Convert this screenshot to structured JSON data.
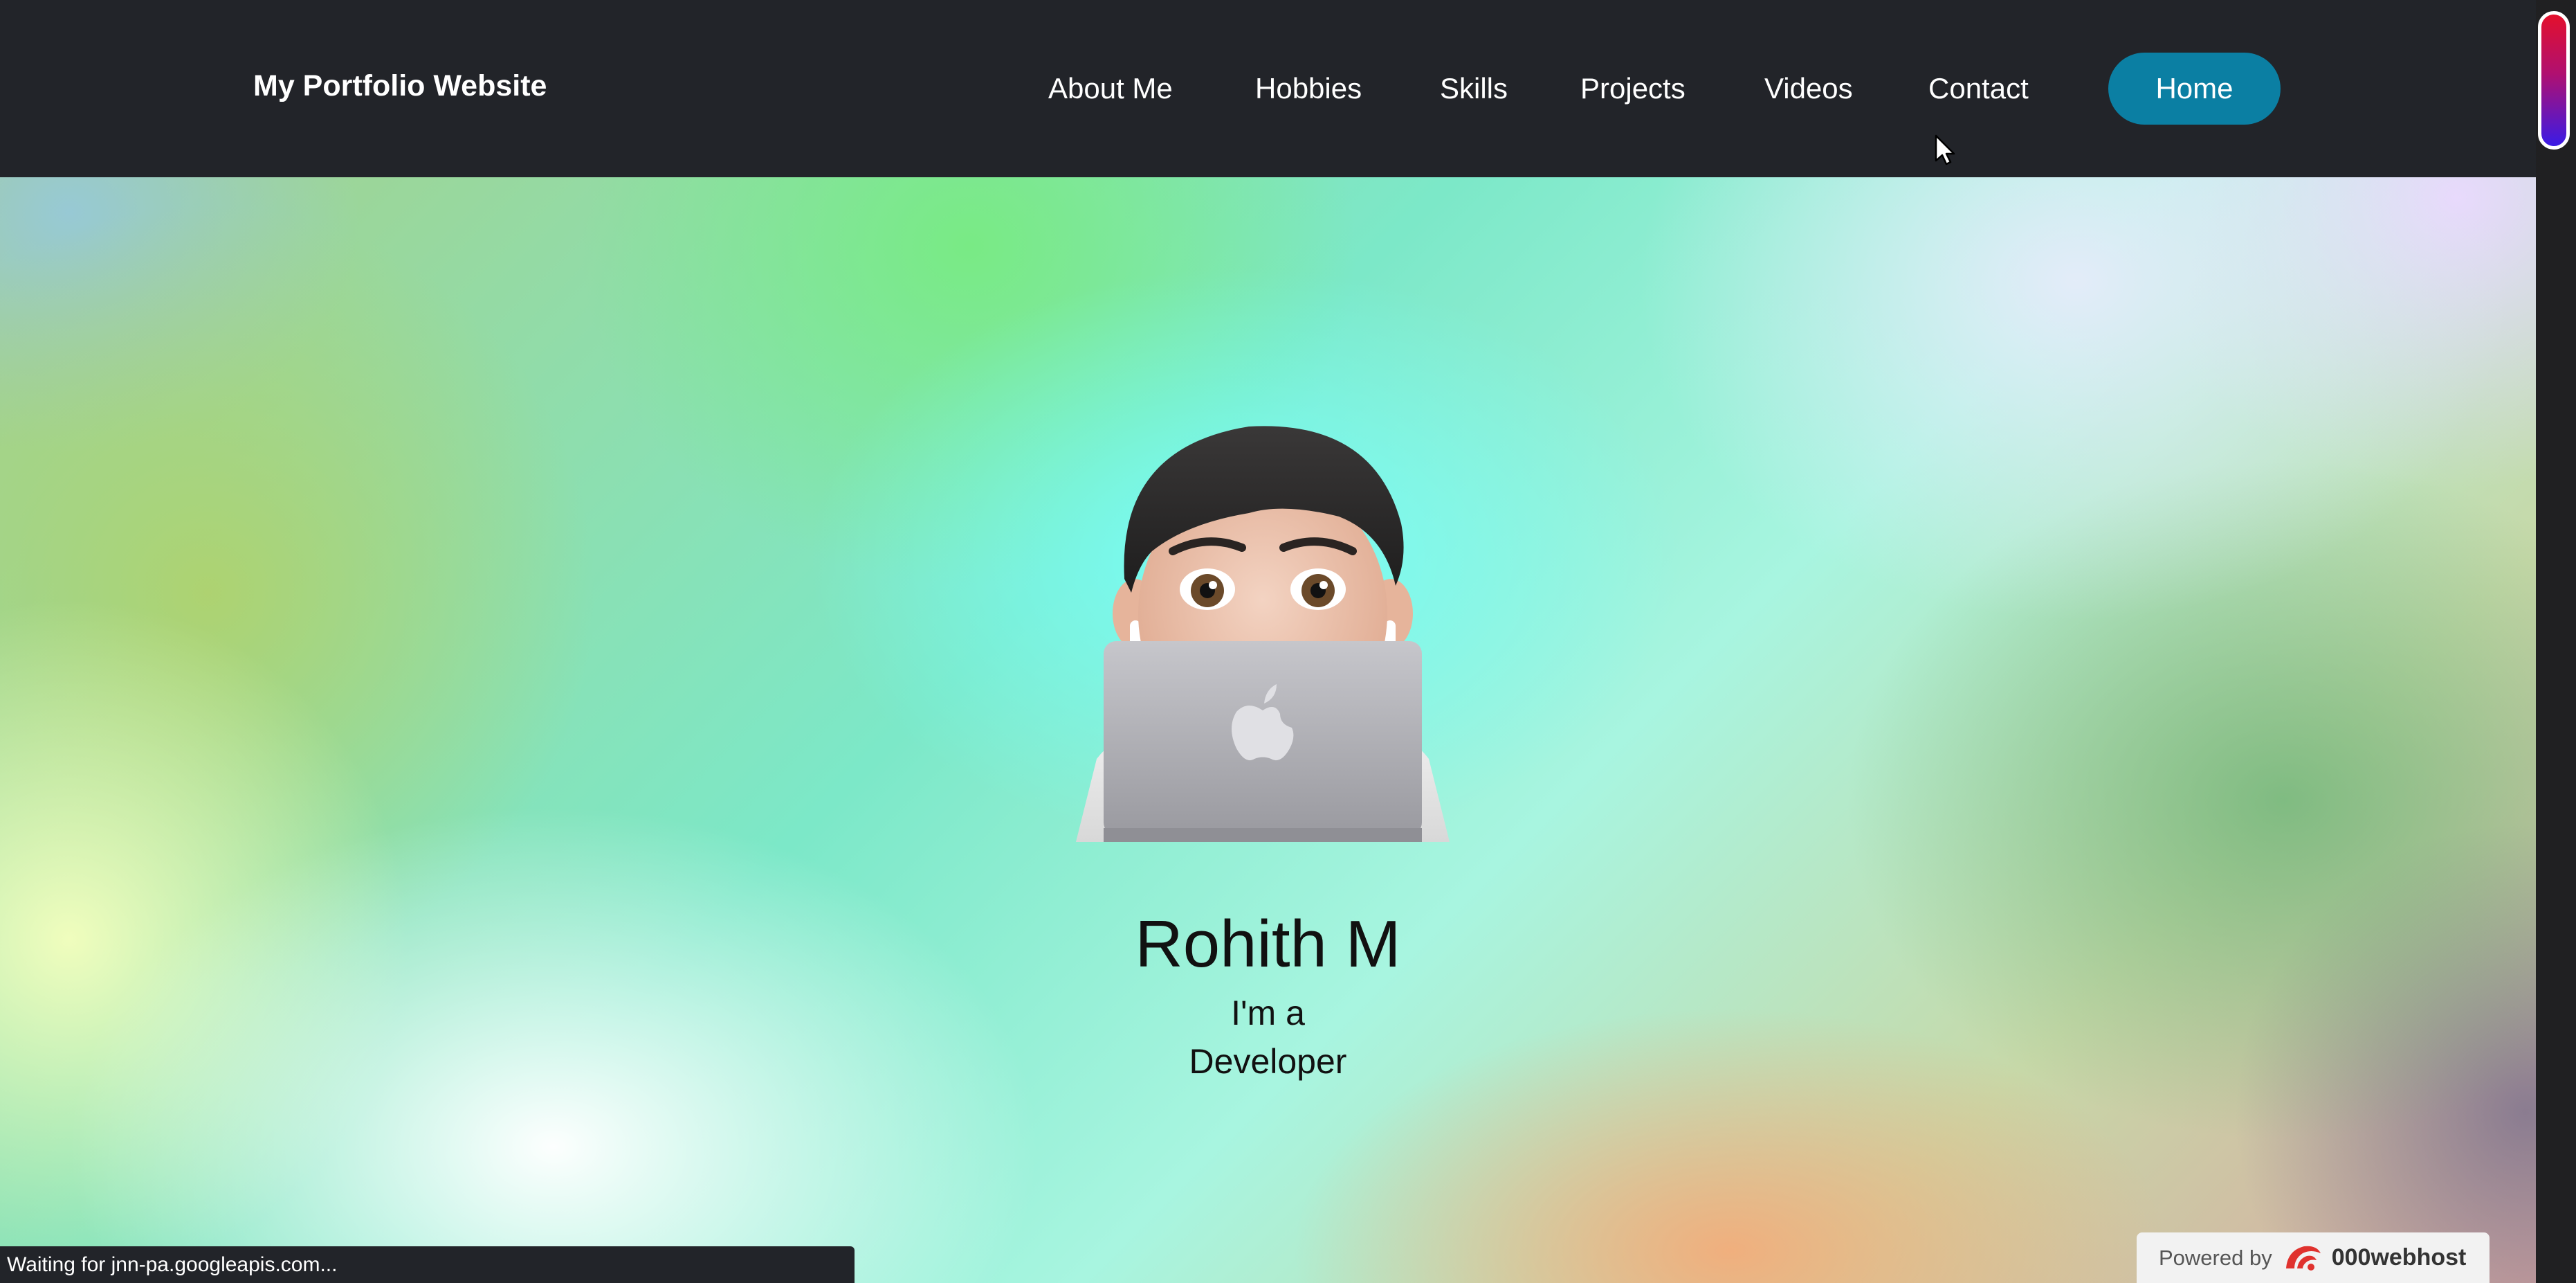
{
  "header": {
    "brand": "My Portfolio Website",
    "nav": {
      "about": "About Me",
      "hobbies": "Hobbies",
      "skills": "Skills",
      "projects": "Projects",
      "videos": "Videos",
      "contact": "Contact",
      "home": "Home"
    },
    "colors": {
      "background": "#222429",
      "home_button": "#0b7fa3"
    }
  },
  "hero": {
    "name": "Rohith M",
    "subtitle_line1": "I'm a",
    "subtitle_line2": "Developer",
    "avatar_icon": "memoji-laptop-icon"
  },
  "status_bar": {
    "text": "Waiting for jnn-pa.googleapis.com..."
  },
  "badge": {
    "powered_by": "Powered by",
    "brand": "000webhost"
  }
}
